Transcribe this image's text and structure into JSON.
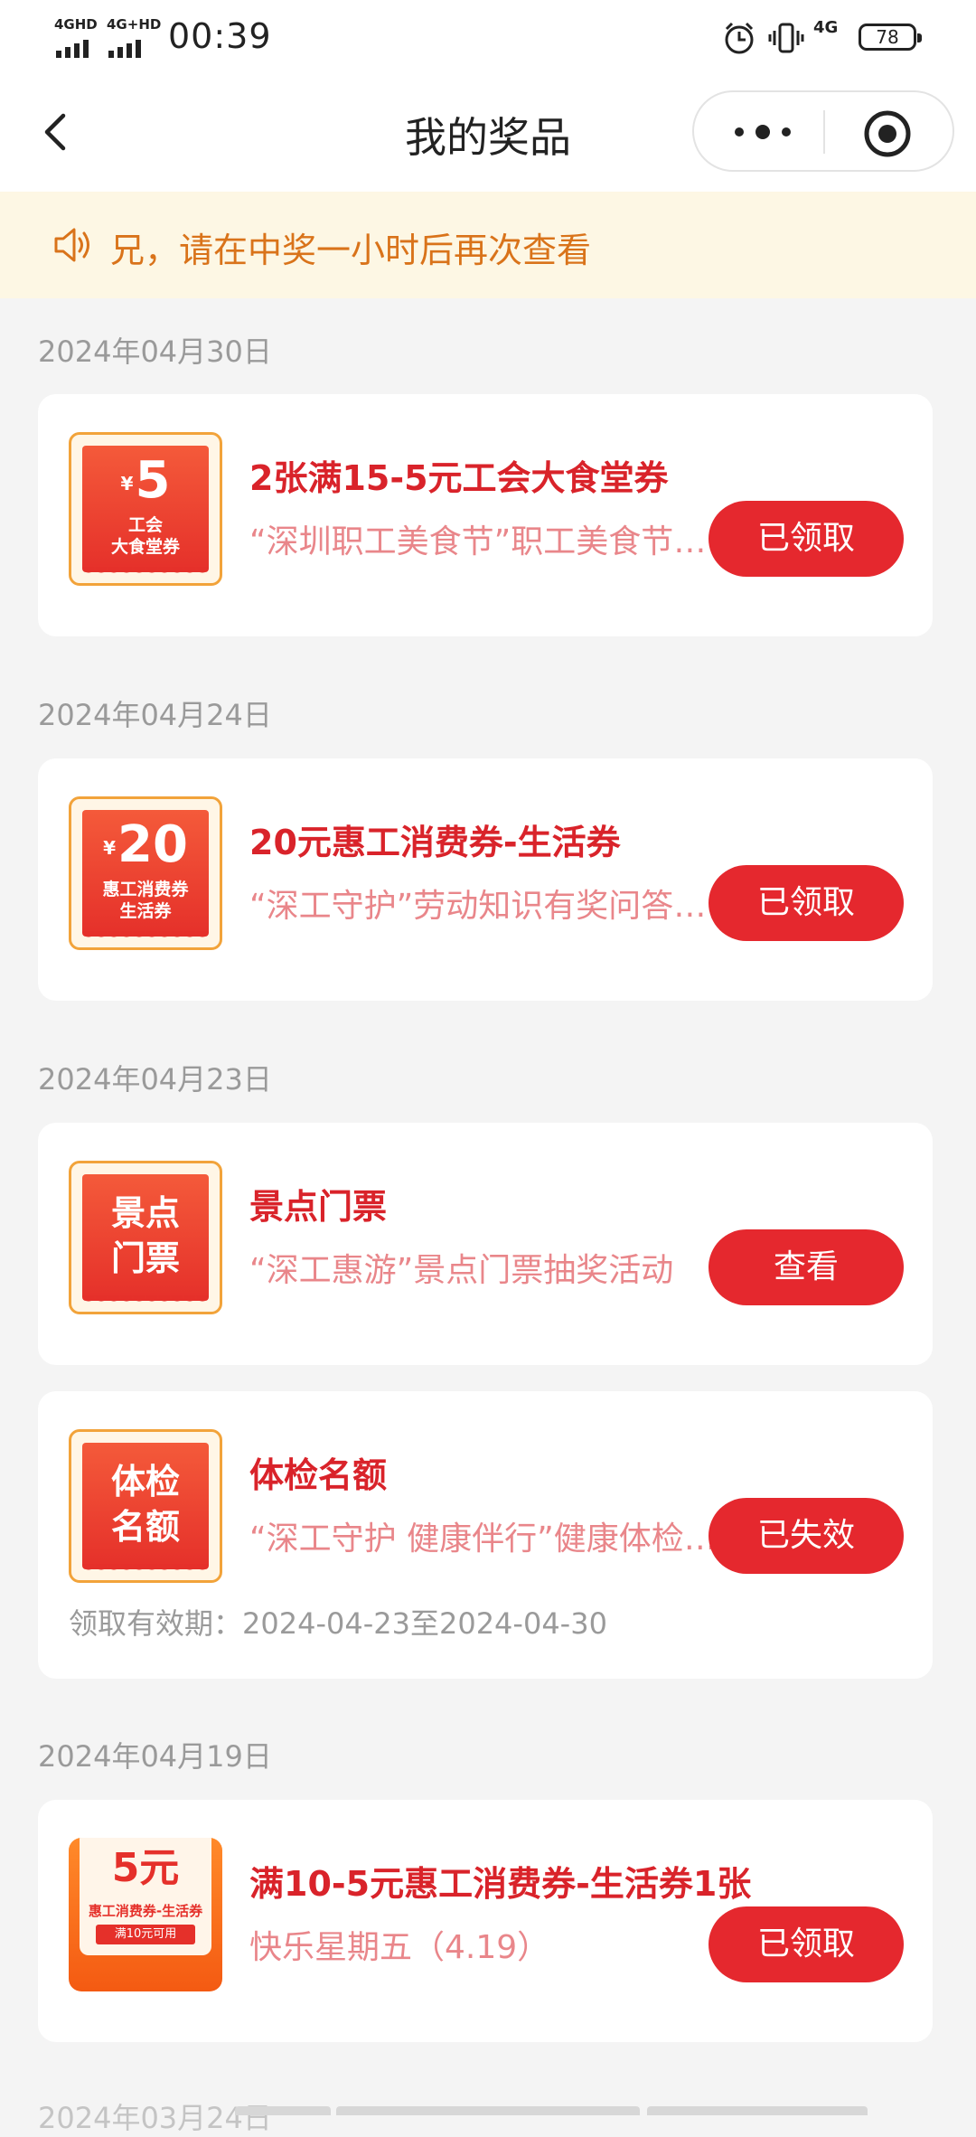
{
  "status_bar": {
    "signal1_label": "4GHD",
    "signal2_label": "4G+HD",
    "time": "00:39",
    "network_label": "4G",
    "battery": "78"
  },
  "nav": {
    "title": "我的奖品"
  },
  "notice": {
    "text": "兄，请在中奖一小时后再次查看"
  },
  "groups": [
    {
      "date": "2024年04月30日",
      "items": [
        {
          "thumb_currency": "¥",
          "thumb_value": "5",
          "thumb_line1": "工会",
          "thumb_line2": "大食堂券",
          "title": "2张满15-5元工会大食堂券",
          "desc": "“深圳职工美食节”职工美食节抽奖活动",
          "button": "已领取"
        }
      ]
    },
    {
      "date": "2024年04月24日",
      "items": [
        {
          "thumb_currency": "¥",
          "thumb_value": "20",
          "thumb_line1": "惠工消费券",
          "thumb_line2": "生活券",
          "title": "20元惠工消费券-生活券",
          "desc": "“深工守护”劳动知识有奖问答活动",
          "button": "已领取"
        }
      ]
    },
    {
      "date": "2024年04月23日",
      "items": [
        {
          "thumb_line1": "景点",
          "thumb_line2": "门票",
          "title": "景点门票",
          "desc": "“深工惠游”景点门票抽奖活动",
          "button": "查看"
        },
        {
          "thumb_line1": "体检",
          "thumb_line2": "名额",
          "title": "体检名额",
          "desc": "“深工守护 健康伴行”健康体检活动",
          "button": "已失效",
          "validity": "领取有效期：2024-04-23至2024-04-30"
        }
      ]
    },
    {
      "date": "2024年04月19日",
      "items": [
        {
          "thumb_value": "5元",
          "thumb_line1": "惠工消费券-生活券",
          "thumb_line2": "满10元可用",
          "title": "满10-5元惠工消费券-生活券1张",
          "desc": "快乐星期五（4.19）",
          "button": "已领取"
        }
      ]
    }
  ],
  "next_date_partial": "2024年03月24日"
}
